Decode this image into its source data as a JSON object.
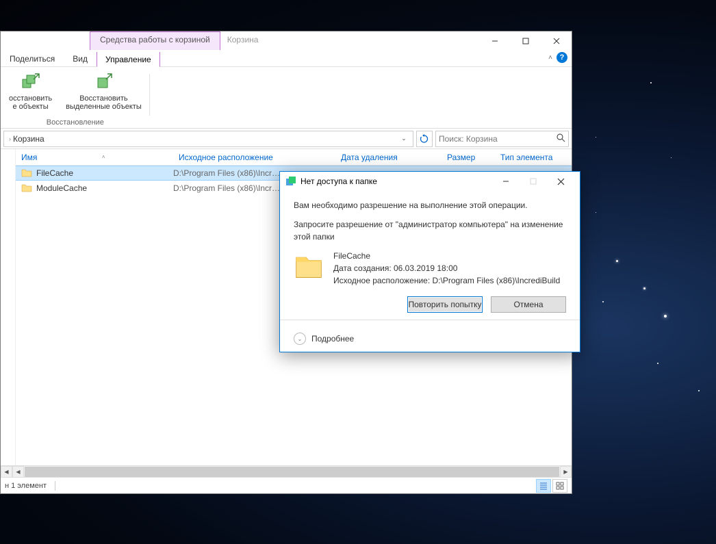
{
  "title_context": "Средства работы с корзиной",
  "window_title": "Корзина",
  "tabs": {
    "share": "Поделиться",
    "view": "Вид",
    "manage": "Управление"
  },
  "ribbon": {
    "restore_all": "осстановить\nе объекты",
    "restore_selected": "Восстановить\nвыделенные объекты",
    "group_label": "Восстановление"
  },
  "address": {
    "location": "Корзина",
    "refresh_tooltip": "Обновить"
  },
  "search": {
    "placeholder": "Поиск: Корзина"
  },
  "columns": {
    "name": "Имя",
    "source": "Исходное расположение",
    "deleted": "Дата удаления",
    "size": "Размер",
    "type": "Тип элемента"
  },
  "items": [
    {
      "name": "FileCache",
      "source": "D:\\Program Files (x86)\\Incr…",
      "selected": true
    },
    {
      "name": "ModuleCache",
      "source": "D:\\Program Files (x86)\\Incr…",
      "selected": false
    }
  ],
  "status": {
    "count_label": "н 1 элемент"
  },
  "dialog": {
    "title": "Нет доступа к папке",
    "line1": "Вам необходимо разрешение на выполнение этой операции.",
    "line2": "Запросите разрешение от \"администратор компьютера\" на изменение этой папки",
    "folder_name": "FileCache",
    "date_created": "Дата создания: 06.03.2019 18:00",
    "source_location": "Исходное расположение: D:\\Program Files (x86)\\IncrediBuild",
    "retry": "Повторить попытку",
    "cancel": "Отмена",
    "more": "Подробнее"
  }
}
